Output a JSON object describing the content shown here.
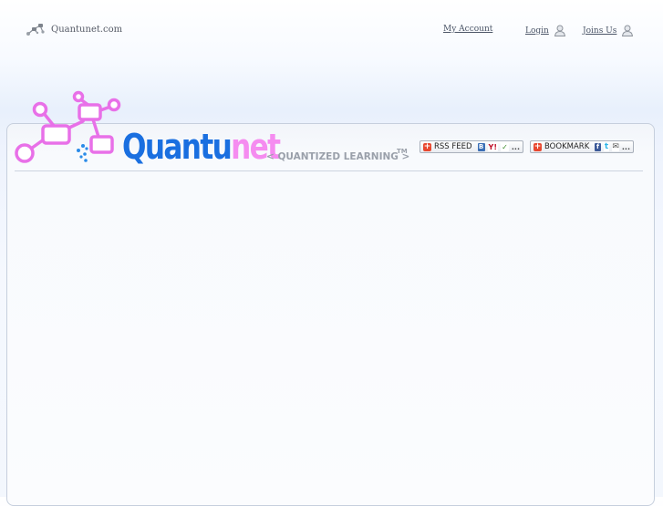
{
  "topbar": {
    "site_name": "Quantunet.com",
    "my_account": "My Account",
    "login": "Login",
    "join": "Joins Us"
  },
  "brand": {
    "name_part1": "Quantu",
    "name_part2": "net",
    "tagline": "< QUANTIZED LEARNING >",
    "trademark": "TM"
  },
  "share": {
    "rss_label": "RSS FEED",
    "bookmark_label": "BOOKMARK",
    "plus": "+",
    "blogger": "B",
    "yahoo": "Y!",
    "msn": "✓",
    "facebook": "f",
    "twitter": "t",
    "mail": "✉",
    "more": "..."
  },
  "colors": {
    "brand_blue": "#1a6fe0",
    "brand_pink": "#f58cf0",
    "molecule_pink": "#e870e8",
    "molecule_blue": "#2a8be8"
  },
  "icons": {
    "site": "molecule-icon",
    "login": "user-icon",
    "join": "user-icon"
  }
}
